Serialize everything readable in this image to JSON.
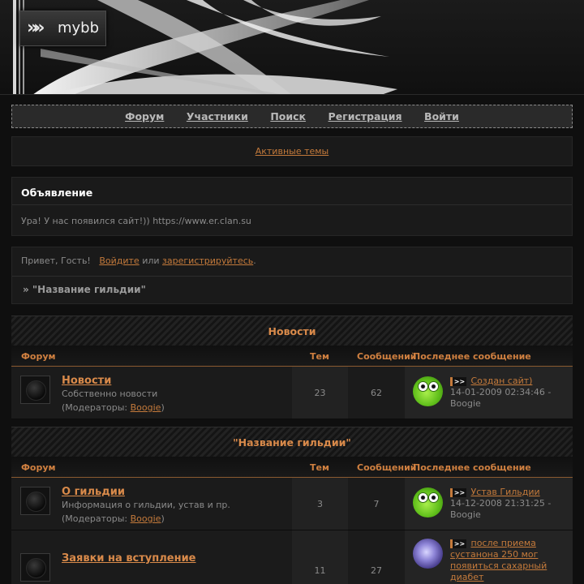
{
  "header": {
    "logo_text": "mybb",
    "logo_icon": "double-chevron-icon"
  },
  "nav": [
    {
      "label": "Форум"
    },
    {
      "label": "Участники"
    },
    {
      "label": "Поиск"
    },
    {
      "label": "Регистрация"
    },
    {
      "label": "Войти"
    }
  ],
  "active_topics": "Активные темы",
  "announcement": {
    "title": "Объявление",
    "text": "Ура! У нас появился сайт!)) https://www.er.clan.su"
  },
  "welcome": {
    "greeting": "Привет, Гость!",
    "login_link": "Войдите",
    "or": "или",
    "register_link": "зарегистрируйтесь",
    "period": ".",
    "breadcrumb": "» \"Название гильдии\""
  },
  "columns": {
    "forum": "Форум",
    "topics": "Тем",
    "posts": "Сообщений",
    "last_post": "Последнее сообщение"
  },
  "categories": [
    {
      "title": "Новости",
      "forums": [
        {
          "name": "Новости",
          "description": "Собственно новости",
          "moderators_prefix": "(Модераторы:",
          "moderator": "Boogie",
          "moderators_suffix": ")",
          "topics": "23",
          "posts": "62",
          "last_title": "Создан сайт)",
          "last_meta": "14-01-2009 02:34:46 - Boogie",
          "avatar": "green-smiley"
        }
      ]
    },
    {
      "title": "\"Название гильдии\"",
      "forums": [
        {
          "name": "О гильдии",
          "description": "Информация о гильдии, устав и пр.",
          "moderators_prefix": "(Модераторы:",
          "moderator": "Boogie",
          "moderators_suffix": ")",
          "topics": "3",
          "posts": "7",
          "last_title": "Устав Гильдии",
          "last_meta": "14-12-2008 21:31:25 - Boogie",
          "avatar": "green-smiley"
        },
        {
          "name": "Заявки на вступление",
          "topics": "11",
          "posts": "27",
          "last_title": "после приема сустанона 250 мог появиться сахарный диабет",
          "avatar": "purple-orb"
        }
      ]
    }
  ],
  "colors": {
    "accent": "#d98a4a",
    "link": "#c47a3b",
    "background": "#0f0f0f"
  }
}
